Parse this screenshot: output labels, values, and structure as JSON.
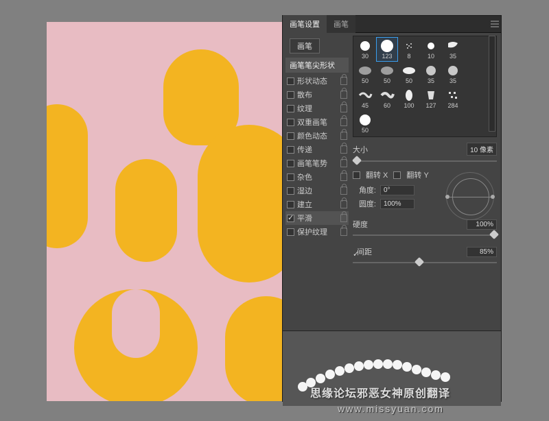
{
  "tabs": {
    "settings": "画笔设置",
    "brush": "画笔"
  },
  "button_brush": "画笔",
  "tip_shape_label": "画笔笔尖形状",
  "options": [
    {
      "label": "形状动态",
      "checked": false,
      "locked": true
    },
    {
      "label": "散布",
      "checked": false,
      "locked": true
    },
    {
      "label": "纹理",
      "checked": false,
      "locked": true
    },
    {
      "label": "双重画笔",
      "checked": false,
      "locked": true
    },
    {
      "label": "颜色动态",
      "checked": false,
      "locked": true
    },
    {
      "label": "传递",
      "checked": false,
      "locked": true
    },
    {
      "label": "画笔笔势",
      "checked": false,
      "locked": true
    },
    {
      "label": "杂色",
      "checked": false,
      "locked": true
    },
    {
      "label": "湿边",
      "checked": false,
      "locked": true
    },
    {
      "label": "建立",
      "checked": false,
      "locked": true
    },
    {
      "label": "平滑",
      "checked": true,
      "locked": true,
      "selected": true
    },
    {
      "label": "保护纹理",
      "checked": false,
      "locked": true
    }
  ],
  "brush_sizes": [
    "30",
    "123",
    "8",
    "10",
    "35",
    "",
    "50",
    "50",
    "50",
    "35",
    "35",
    "",
    "45",
    "60",
    "100",
    "127",
    "284",
    "",
    "50",
    "",
    "",
    "",
    "",
    ""
  ],
  "selected_brush_index": 1,
  "size": {
    "label": "大小",
    "value": "10 像素"
  },
  "flip": {
    "x_label": "翻转 X",
    "y_label": "翻转 Y"
  },
  "angle": {
    "label": "角度:",
    "value": "0°"
  },
  "roundness": {
    "label": "圆度:",
    "value": "100%"
  },
  "hardness": {
    "label": "硬度",
    "value": "100%"
  },
  "spacing": {
    "label": "间距",
    "value": "85%",
    "checked": true
  },
  "watermark": {
    "line1": "思缘论坛邪恶女神原创翻译",
    "line2": "www.missyuan.com"
  }
}
